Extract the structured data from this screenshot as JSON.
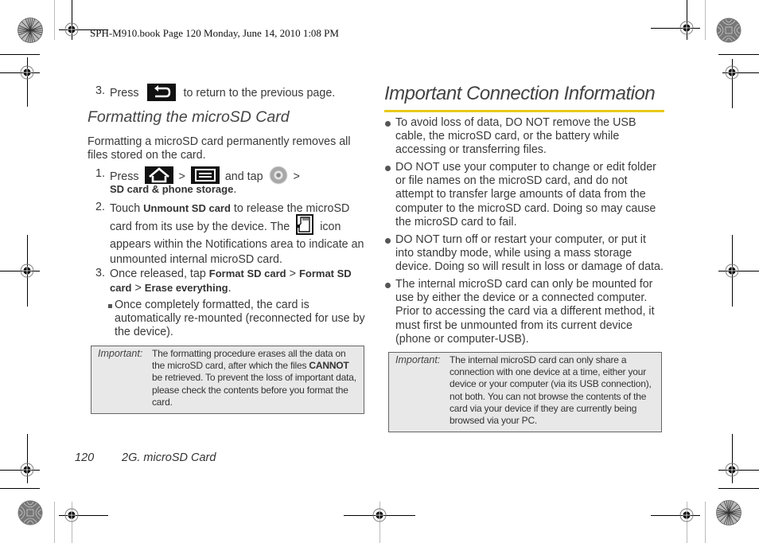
{
  "slug": "SPH-M910.book  Page 120  Monday, June 14, 2010  1:08 PM",
  "left_column": {
    "step3_prev": {
      "num": "3.",
      "before": "Press",
      "icon": "back-key-icon",
      "after": "to return to the previous page."
    },
    "section_title": "Formatting the microSD Card",
    "intro": "Formatting a microSD card permanently removes all files stored on the card.",
    "steps": [
      {
        "num": "1.",
        "press": "Press",
        "icon1": "home-key-icon",
        "sep1": ">",
        "icon2": "menu-key-icon",
        "and_tap": "and tap",
        "icon3": "settings-icon",
        "sep2": ">",
        "path": "SD card & phone storage",
        "end": "."
      },
      {
        "num": "2.",
        "touch": "Touch",
        "bold": "Unmount SD card",
        "line1_rest": "to release the microSD",
        "line2": "card from its use by the device. The",
        "icon": "sd-card-notification-icon",
        "icon_after": "icon",
        "line3": "appears within the Notifications area to indicate an",
        "line4": "unmounted internal microSD card."
      },
      {
        "num": "3.",
        "before": "Once released, tap",
        "path1": "Format SD card",
        "sep": ">",
        "path2": "Format SD",
        "path2b": "card",
        "path3": "Erase everything",
        "end": "."
      }
    ],
    "sub_bullet": {
      "line1": "Once completely formatted, the card is",
      "line2": "automatically re-mounted (reconnected for use by",
      "line3": "the device)."
    },
    "important": {
      "label": "Important:",
      "lines": [
        "The formatting procedure erases all the data on",
        "the microSD card, after which the files",
        "be retrieved. To prevent the loss of important data,",
        "please check the contents before you format the",
        "card."
      ],
      "bold_word": "CANNOT"
    }
  },
  "right_column": {
    "section_title": "Important Connection Information",
    "accent_color": "#e8c81a",
    "bullets": [
      [
        "To avoid loss of data, DO NOT remove the USB",
        "cable, the microSD card, or the battery while",
        "accessing or transferring files."
      ],
      [
        "DO NOT use your computer to change or edit folder",
        "or file names on the microSD card, and do not",
        "attempt to transfer large amounts of data from the",
        "computer to the microSD card. Doing so may cause",
        "the microSD card to fail."
      ],
      [
        "DO NOT turn off or restart your computer, or put it",
        "into standby mode, while using a mass storage",
        "device. Doing so will result in loss or damage of data."
      ],
      [
        "The internal microSD card can only be mounted for",
        "use by either the device or a connected computer.",
        "Prior to accessing the card via a different method, it",
        "must first be unmounted from its current device",
        "(phone or computer-USB)."
      ]
    ],
    "important": {
      "label": "Important:",
      "lines": [
        "The internal microSD card can only share a",
        "connection with one device at a time, either your",
        "device or your computer (via its USB connection),",
        "not both. You can not browse the contents of the",
        "card via your device if they are currently being",
        "browsed via your PC."
      ]
    }
  },
  "footer": {
    "page_number": "120",
    "section": "2G. microSD Card"
  }
}
